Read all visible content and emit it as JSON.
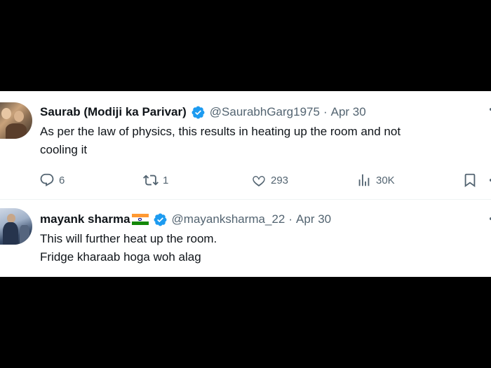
{
  "tweets": [
    {
      "name": "Saurab (Modiji ka Parivar)",
      "handle": "@SaurabhGarg1975",
      "separator": "·",
      "date": "Apr 30",
      "lines": [
        "As per the law of physics, this results in heating up the room and not",
        "cooling it"
      ],
      "stats": {
        "replies": "6",
        "reposts": "1",
        "likes": "293",
        "views": "30K"
      }
    },
    {
      "name": "mayank sharma",
      "handle": "@mayanksharma_22",
      "separator": "·",
      "date": "Apr 30",
      "lines": [
        "This will further heat up the room.",
        "Fridge kharaab hoga woh alag"
      ]
    }
  ],
  "colors": {
    "verified": "#1d9bf0",
    "text": "#0f1419",
    "secondary": "#536471",
    "flag_saffron": "#ff9933",
    "flag_green": "#138808"
  },
  "icons": {
    "verified": "verified-badge-icon",
    "reply": "reply-icon",
    "repost": "repost-icon",
    "like": "heart-icon",
    "views": "views-chart-icon",
    "bookmark": "bookmark-icon",
    "flag": "india-flag-icon"
  }
}
